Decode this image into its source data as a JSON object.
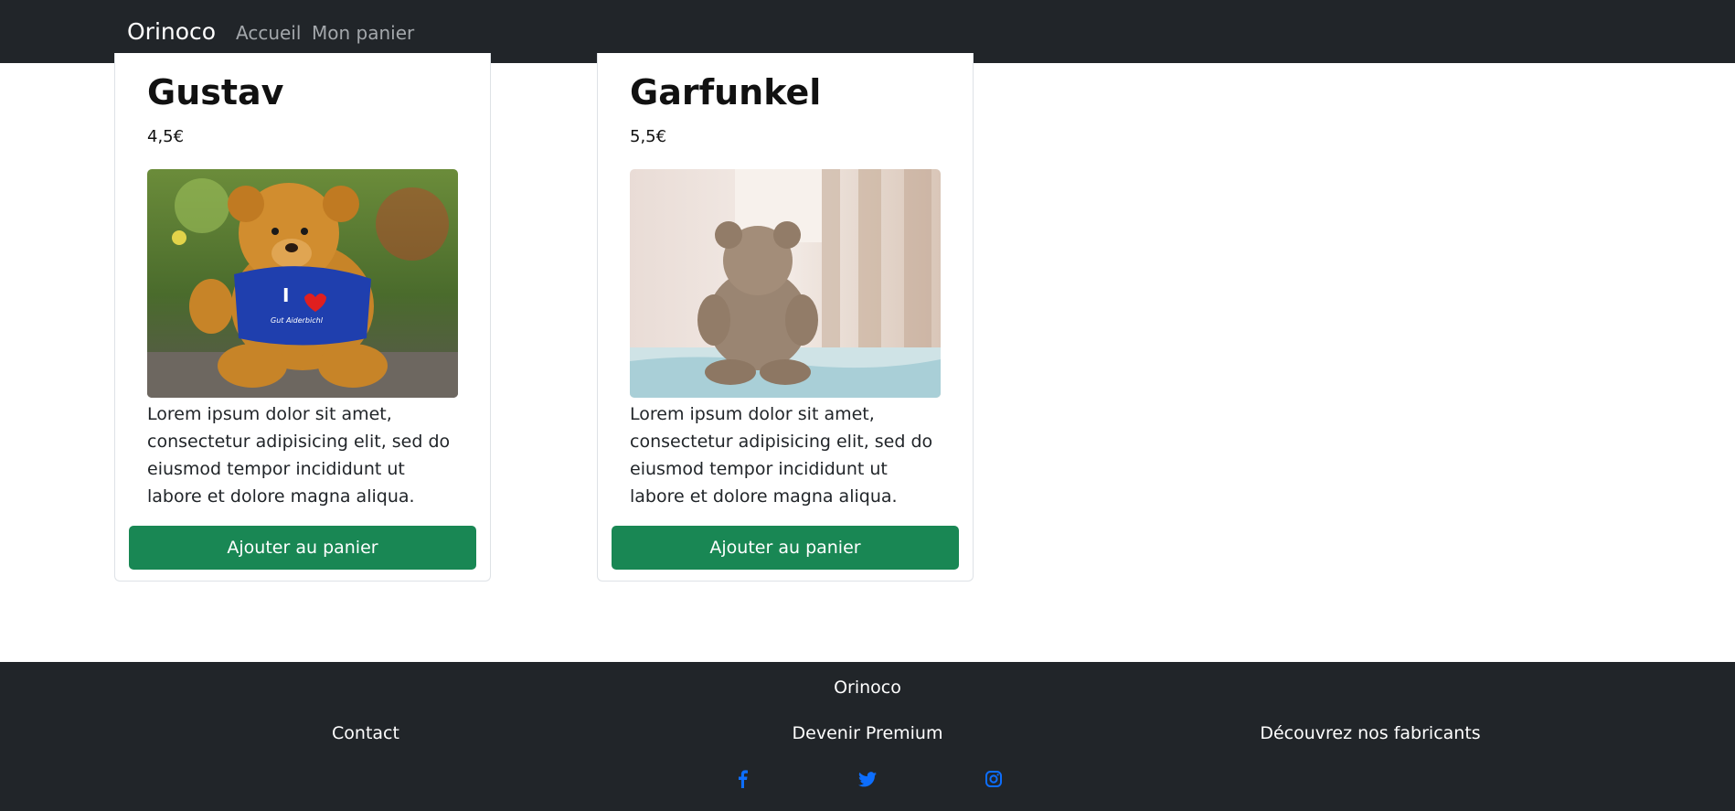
{
  "navbar": {
    "brand": "Orinoco",
    "links": [
      {
        "label": "Accueil"
      },
      {
        "label": "Mon panier"
      }
    ]
  },
  "products": [
    {
      "name": "Gustav",
      "price": "4,5€",
      "description": "Lorem ipsum dolor sit amet, consectetur adipisicing elit, sed do eiusmod tempor incididunt ut labore et dolore magna aliqua.",
      "button_label": "Ajouter au panier"
    },
    {
      "name": "Garfunkel",
      "price": "5,5€",
      "description": "Lorem ipsum dolor sit amet, consectetur adipisicing elit, sed do eiusmod tempor incididunt ut labore et dolore magna aliqua.",
      "button_label": "Ajouter au panier"
    }
  ],
  "footer": {
    "brand": "Orinoco",
    "links": [
      {
        "label": "Contact"
      },
      {
        "label": "Devenir Premium"
      },
      {
        "label": "Découvrez nos fabricants"
      }
    ],
    "social": [
      {
        "icon": "facebook-icon"
      },
      {
        "icon": "twitter-icon"
      },
      {
        "icon": "instagram-icon"
      }
    ]
  },
  "colors": {
    "navbar_bg": "#212529",
    "button_bg": "#198754",
    "social_icon": "#0d6efd",
    "nav_link": "#a3a7ab"
  }
}
